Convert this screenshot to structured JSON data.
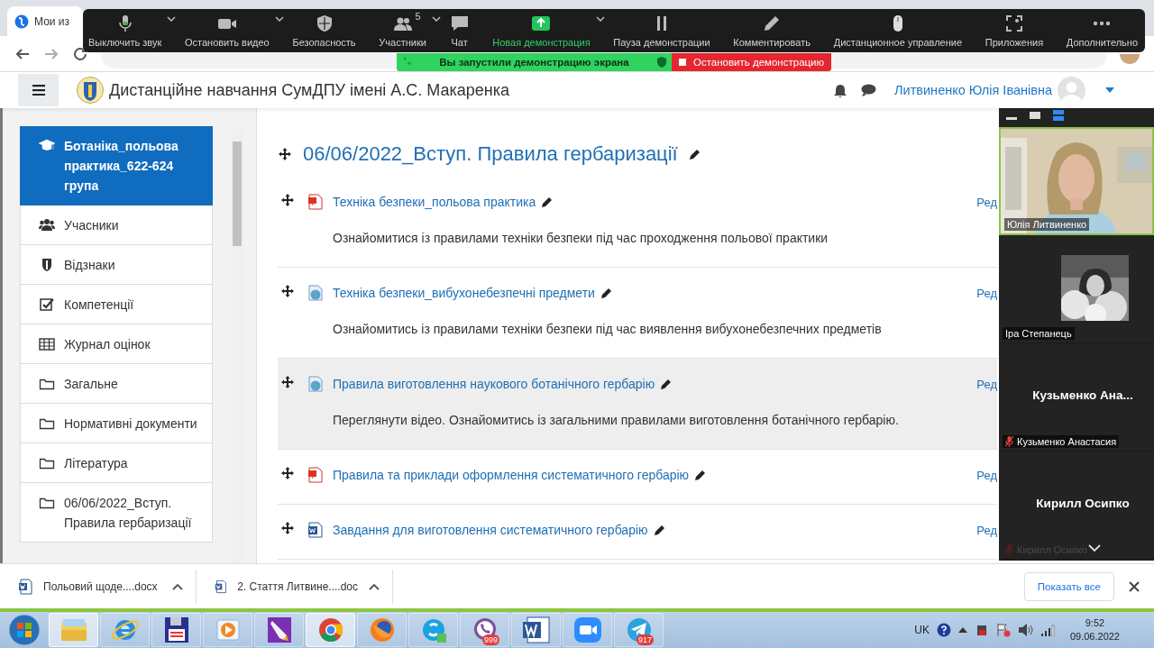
{
  "browser": {
    "tab_title": "Мои из"
  },
  "zoom_toolbar": {
    "items": [
      {
        "kind": "mic",
        "label": "Выключить звук",
        "menu": true,
        "highlighted": false
      },
      {
        "kind": "camera",
        "label": "Остановить видео",
        "menu": true,
        "highlighted": false
      },
      {
        "kind": "security",
        "label": "Безопасность",
        "menu": false,
        "highlighted": false
      },
      {
        "kind": "participants",
        "label": "Участники",
        "badge": "5",
        "menu": true,
        "highlighted": false
      },
      {
        "kind": "chat",
        "label": "Чат",
        "menu": false,
        "highlighted": false
      },
      {
        "kind": "share",
        "label": "Новая демонстрация",
        "menu": true,
        "highlighted": true
      },
      {
        "kind": "pause",
        "label": "Пауза демонстрации",
        "menu": false,
        "highlighted": false
      },
      {
        "kind": "annotate",
        "label": "Комментировать",
        "menu": false,
        "highlighted": false
      },
      {
        "kind": "remote",
        "label": "Дистанционное управление",
        "menu": false,
        "highlighted": false
      },
      {
        "kind": "apps",
        "label": "Приложения",
        "menu": false,
        "highlighted": false
      },
      {
        "kind": "more",
        "label": "Дополнительно",
        "menu": false,
        "highlighted": false
      }
    ]
  },
  "share_banner": {
    "status": "Вы запустили демонстрацию экрана",
    "stop_button": "Остановить демонстрацию"
  },
  "header": {
    "site_title": "Дистанційне навчання СумДПУ імені А.С. Макаренка",
    "user_name": "Литвиненко Юлія Іванівна"
  },
  "drawer": {
    "items": [
      {
        "kind": "course",
        "label": "Ботаніка_польова практика_622-624 група",
        "selected": true
      },
      {
        "kind": "users",
        "label": "Учасники",
        "selected": false
      },
      {
        "kind": "badges",
        "label": "Відзнаки",
        "selected": false
      },
      {
        "kind": "competencies",
        "label": "Компетенції",
        "selected": false
      },
      {
        "kind": "grades",
        "label": "Журнал оцінок",
        "selected": false
      },
      {
        "kind": "folder",
        "label": "Загальне",
        "selected": false
      },
      {
        "kind": "folder",
        "label": "Нормативні документи",
        "selected": false
      },
      {
        "kind": "folder",
        "label": "Література",
        "selected": false
      },
      {
        "kind": "folder",
        "label": "06/06/2022_Вступ. Правила гербаризації",
        "selected": false
      }
    ]
  },
  "section": {
    "title": "06/06/2022_Вступ. Правила гербаризації",
    "activities": [
      {
        "kind": "pdf",
        "title": "Техніка безпеки_польова практика",
        "description": "Ознайомитися із правилами техніки безпеки під час проходження польової практики",
        "edit_link": "Ред",
        "highlighted": false
      },
      {
        "kind": "url",
        "title": "Техніка безпеки_вибухонебезпечні предмети",
        "description": "Ознайомитись із правилами техніки безпеки під час виявлення вибухонебезпечних предметів",
        "edit_link": "Ред",
        "highlighted": false
      },
      {
        "kind": "url",
        "title": "Правила виготовлення наукового ботанічного гербарію",
        "description": "Переглянути відео. Ознайомитись із загальними правилами виготовлення ботанічного гербарію.",
        "edit_link": "Ред",
        "highlighted": true
      },
      {
        "kind": "pdf",
        "title": "Правила та приклади оформлення систематичного гербарію",
        "edit_link": "Ред",
        "highlighted": false
      },
      {
        "kind": "word",
        "title": "Завдання для виготовлення систематичного гербарію",
        "edit_link": "Ред",
        "highlighted": false
      }
    ]
  },
  "video_panel": {
    "tiles": [
      {
        "kind": "video",
        "label": "Юлія Литвиненко",
        "muted": false,
        "speaking": true
      },
      {
        "label": "Іра Степанець",
        "muted": false,
        "speaking": false
      },
      {
        "kind": "name",
        "display_name": "Кузьменко Ана...",
        "label": "Кузьменко Анастасия",
        "muted": true,
        "speaking": false
      },
      {
        "kind": "name",
        "display_name": "Кирилл Осипко",
        "label": "Кирилл Осипко",
        "muted": true,
        "speaking": false
      }
    ]
  },
  "downloads": {
    "files": [
      {
        "name": "Польовий щоде....docx"
      },
      {
        "name": "2. Стаття Литвине....doc"
      }
    ],
    "show_all_button": "Показать все"
  },
  "taskbar": {
    "apps": [
      {
        "kind": "explorer",
        "active": true
      },
      {
        "kind": "ie",
        "active": false
      },
      {
        "kind": "floppy",
        "active": false
      },
      {
        "kind": "media",
        "active": false
      },
      {
        "kind": "notes",
        "active": false
      },
      {
        "kind": "chrome",
        "active": true
      },
      {
        "kind": "firefox",
        "active": false
      },
      {
        "kind": "skype",
        "active": false
      },
      {
        "kind": "viber",
        "badge": "999",
        "active": false
      },
      {
        "kind": "word",
        "active": false
      },
      {
        "kind": "zoom",
        "active": false
      },
      {
        "kind": "telegram",
        "badge": "917",
        "active": false
      }
    ],
    "tray": {
      "language": "UK",
      "time": "9:52",
      "date": "09.06.2022"
    }
  }
}
